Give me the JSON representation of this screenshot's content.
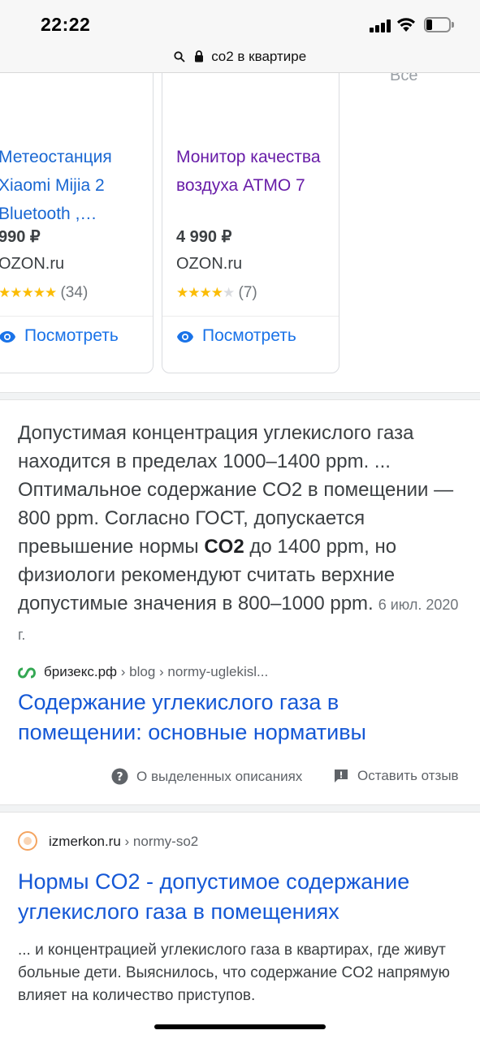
{
  "status_bar": {
    "time": "22:22"
  },
  "url_bar": {
    "query": "co2 в квартире"
  },
  "products": [
    {
      "title": "Метеостанция Xiaomi Mijia 2 Bluetooth ,…",
      "price": "990 ₽",
      "seller": "OZON.ru",
      "rating": 5,
      "reviews": "(34)",
      "button": "Посмотреть"
    },
    {
      "title": "Монитор качества воздуха ATMO 7",
      "price": "4 990 ₽",
      "seller": "OZON.ru",
      "rating": 4,
      "reviews": "(7)",
      "button": "Посмотреть"
    }
  ],
  "carousel_all_label": "Все",
  "featured_snippet": {
    "text_before": "Допустимая концентрация углекислого газа находится в пределах 1000–1400 ppm. ... Оптимальное содержание CO2 в помещении — 800 ppm. Согласно ГОСТ, допускается превышение нормы ",
    "text_bold": "CO2",
    "text_after": " до 1400 ppm, но физиологи рекомендуют считать верхние допустимые значения в 800–1000 ppm.",
    "date": "6 июл. 2020 г.",
    "source_domain": "бризекс.рф",
    "source_path": "› blog › normy-uglekisl...",
    "link_title": "Содержание углекислого газа в помещении: основные нормативы",
    "about_label": "О выделенных описаниях",
    "feedback_label": "Оставить отзыв"
  },
  "result2": {
    "domain": "izmerkon.ru",
    "path": "› normy-so2",
    "title": "Нормы CO2 - допустимое содержание углекислого газа в помещениях",
    "description": "... и концентрацией углекислого газа в квартирах, где живут больные дети. Выяснилось, что содержание CO2 напрямую влияет на количество приступов."
  },
  "colors": {
    "link_blue": "#1558d6",
    "visited_purple": "#681da8",
    "star_yellow": "#fbbc04",
    "view_blue": "#1a73e8"
  }
}
